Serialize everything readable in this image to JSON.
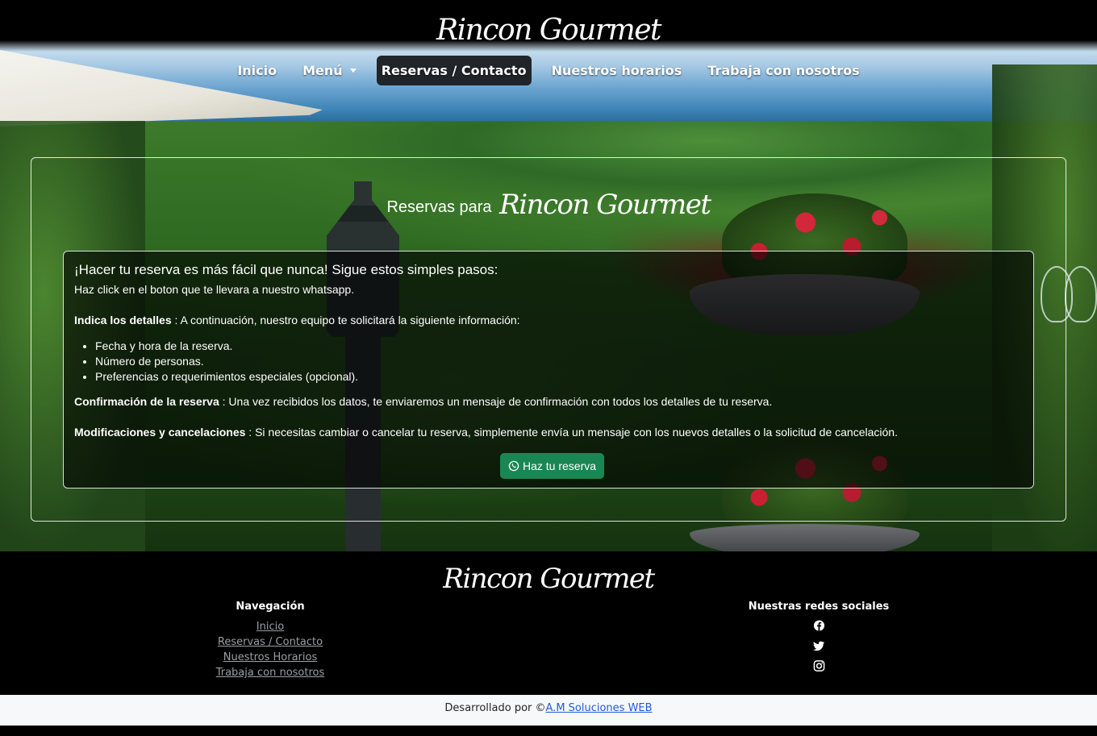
{
  "brand": "Rincon Gourmet",
  "nav": {
    "items": [
      {
        "label": "Inicio",
        "active": false
      },
      {
        "label": "Menú",
        "active": false,
        "dropdown": true
      },
      {
        "label": "Reservas / Contacto",
        "active": true
      },
      {
        "label": "Nuestros horarios",
        "active": false
      },
      {
        "label": "Trabaja con nosotros",
        "active": false
      }
    ]
  },
  "reservas": {
    "title_prefix": "Reservas para",
    "title_brand": "Rincon Gourmet",
    "heading": "¡Hacer tu reserva es más fácil que nunca! Sigue estos simples pasos:",
    "step1": "Haz click en el boton que te llevara a nuestro whatsapp.",
    "details_label": "Indica los detalles",
    "details_text": " : A continuación, nuestro equipo te solicitará la siguiente información:",
    "details_items": [
      "Fecha y hora de la reserva.",
      "Número de personas.",
      "Preferencias o requerimientos especiales (opcional)."
    ],
    "confirm_label": "Confirmación de la reserva",
    "confirm_text": " : Una vez recibidos los datos, te enviaremos un mensaje de confirmación con todos los detalles de tu reserva.",
    "modify_label": "Modificaciones y cancelaciones",
    "modify_text": " : Si necesitas cambiar o cancelar tu reserva, simplemente envía un mensaje con los nuevos detalles o la solicitud de cancelación.",
    "button_label": "Haz tu reserva",
    "button_icon": "whatsapp-icon"
  },
  "footer": {
    "brand": "Rincon Gourmet",
    "nav_heading": "Navegación",
    "nav_links": [
      "Inicio",
      "Reservas / Contacto",
      "Nuestros Horarios",
      "Trabaja con nosotros"
    ],
    "social_heading": "Nuestras redes sociales",
    "social_icons": [
      "facebook-icon",
      "twitter-icon",
      "instagram-icon"
    ]
  },
  "credits": {
    "prefix": "Desarrollado por ©",
    "link": "A.M Soluciones WEB"
  },
  "colors": {
    "whatsapp_button": "#198754",
    "active_nav": "#212529",
    "credits_link": "#1f5bd6"
  }
}
